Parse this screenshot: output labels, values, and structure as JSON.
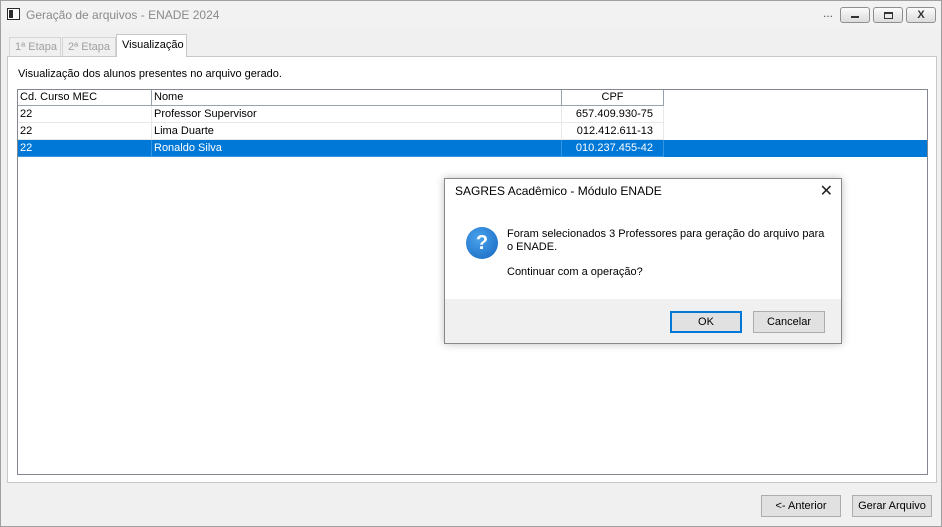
{
  "window": {
    "title": "Geração de arquivos - ENADE 2024",
    "dots": "...",
    "close_glyph": "X"
  },
  "tabs": [
    {
      "label": "1ª Etapa",
      "active": false
    },
    {
      "label": "2ª Etapa",
      "active": false
    },
    {
      "label": "Visualização",
      "active": true
    }
  ],
  "panel": {
    "description": "Visualização dos alunos presentes no arquivo gerado."
  },
  "grid": {
    "columns": [
      "Cd. Curso MEC",
      "Nome",
      "CPF"
    ],
    "rows": [
      {
        "curso": "22",
        "nome": "Professor Supervisor",
        "cpf": "657.409.930-75",
        "selected": false
      },
      {
        "curso": "22",
        "nome": "Lima Duarte",
        "cpf": "012.412.611-13",
        "selected": false
      },
      {
        "curso": "22",
        "nome": "Ronaldo Silva",
        "cpf": "010.237.455-42",
        "selected": true
      }
    ],
    "selection_color": "#0078d7"
  },
  "buttons": {
    "prev": "<- Anterior",
    "gerar": "Gerar Arquivo"
  },
  "dialog": {
    "title": "SAGRES Acadêmico - Módulo ENADE",
    "close_glyph": "✕",
    "icon": "question-icon",
    "icon_glyph": "?",
    "message": "Foram selecionados 3 Professores para geração do arquivo para o ENADE.",
    "question": "Continuar com a operação?",
    "ok_label": "OK",
    "cancel_label": "Cancelar"
  }
}
